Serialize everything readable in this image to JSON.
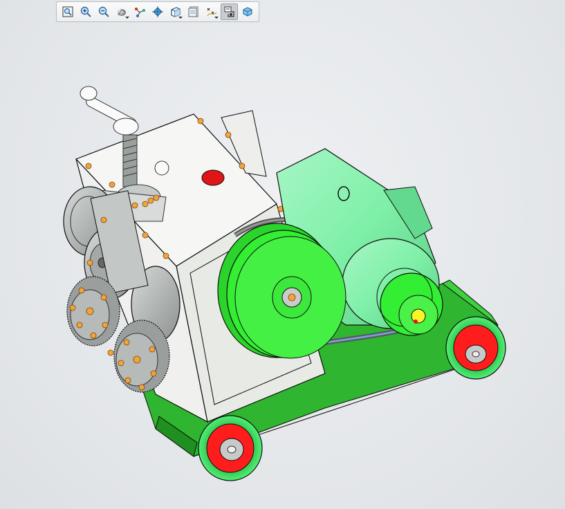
{
  "toolbar": {
    "buttons": [
      {
        "name": "zoom-fit-icon",
        "active": false,
        "dropdown": false
      },
      {
        "name": "zoom-in-icon",
        "active": false,
        "dropdown": false
      },
      {
        "name": "zoom-out-icon",
        "active": false,
        "dropdown": false
      },
      {
        "name": "shading-icon",
        "active": false,
        "dropdown": true
      },
      {
        "name": "datum-display-icon",
        "active": false,
        "dropdown": false
      },
      {
        "name": "spin-center-icon",
        "active": false,
        "dropdown": false
      },
      {
        "name": "view-cube-icon",
        "active": false,
        "dropdown": true
      },
      {
        "name": "saved-views-icon",
        "active": false,
        "dropdown": false
      },
      {
        "name": "datum-points-icon",
        "active": false,
        "dropdown": true
      },
      {
        "name": "annotation-display-icon",
        "active": true,
        "dropdown": false
      },
      {
        "name": "appearance-icon",
        "active": false,
        "dropdown": false
      }
    ]
  },
  "model": {
    "colors": {
      "base_frame": "#2fb52f",
      "motor_body": "#7ff0a8",
      "pulley": "#33ee33",
      "housing": "#f4f5f2",
      "roller": "#b7bcbb",
      "gear": "#9a9e9c",
      "wheel_tire": "#40e060",
      "wheel_hub": "#ff1c1c",
      "bolt": "#f2a33a",
      "knob": "#e01515",
      "motor_center": "#f5f52a"
    }
  }
}
